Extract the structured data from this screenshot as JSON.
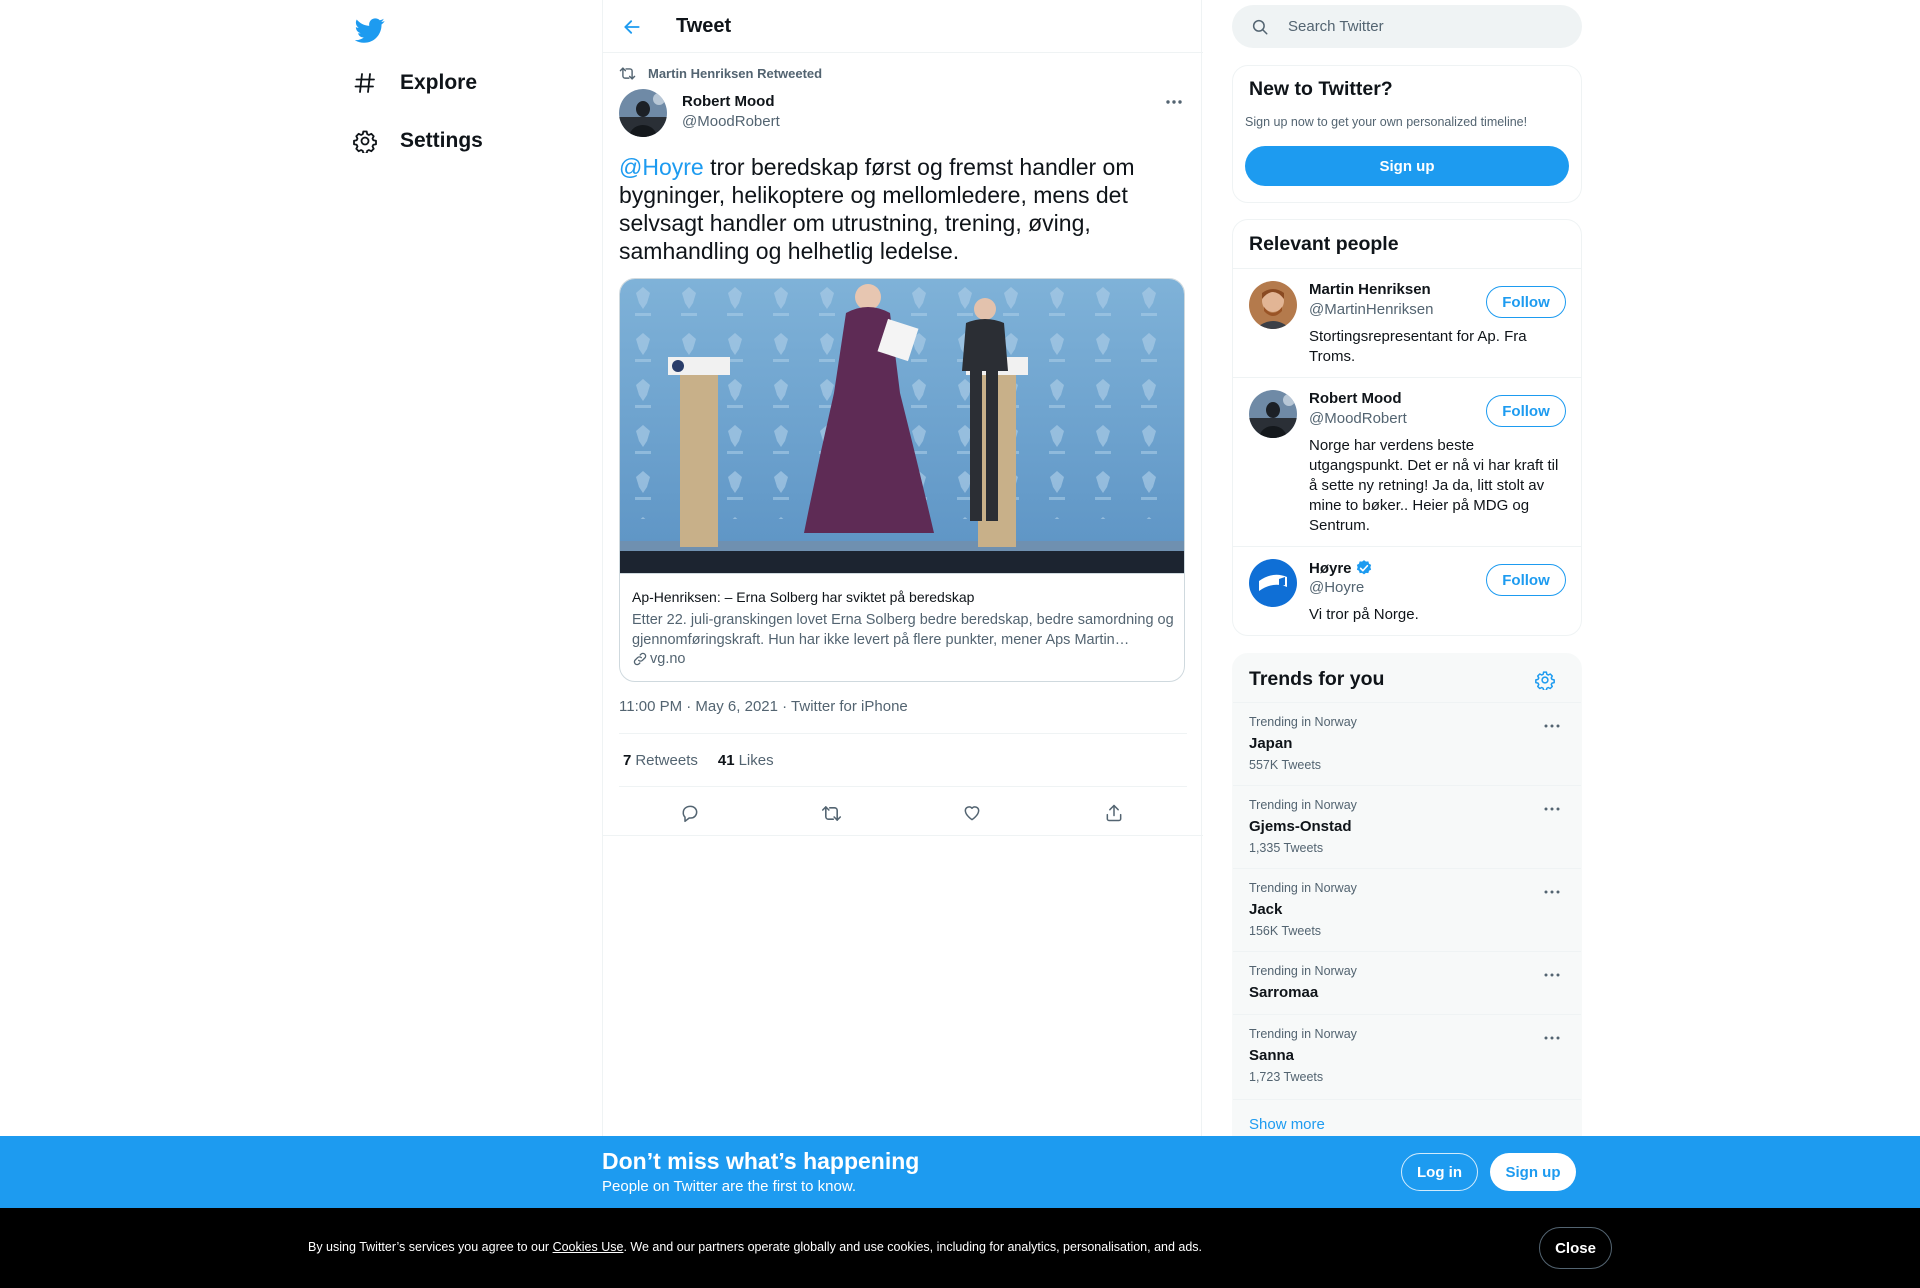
{
  "nav": {
    "logo_icon": "twitter-bird-icon",
    "items": [
      {
        "label": "Explore",
        "icon": "hashtag-icon"
      },
      {
        "label": "Settings",
        "icon": "gear-icon"
      }
    ]
  },
  "main": {
    "header_title": "Tweet",
    "back_icon": "arrow-left-icon",
    "retweet_context": "Martin Henriksen Retweeted",
    "author": {
      "name": "Robert Mood",
      "handle": "@MoodRobert"
    },
    "tweet": {
      "mention": "@Hoyre",
      "text": " tror beredskap først og fremst handler om bygninger, helikoptere og mellomledere, mens det selvsagt handler om utrustning, trening, øving, samhandling og helhetlig ledelse."
    },
    "card": {
      "title": "Ap-Henriksen: – Erna Solberg har sviktet på beredskap",
      "description": "Etter 22. juli-granskingen lovet Erna Solberg bedre beredskap, bedre samordning og gjennomføringskraft. Hun har ikke levert på flere punkter, mener Aps Martin…",
      "domain": "vg.no"
    },
    "meta": "11:00 PM · May 6, 2021 · Twitter for iPhone",
    "stats": {
      "retweets_count": "7",
      "retweets_label": "Retweets",
      "likes_count": "41",
      "likes_label": "Likes"
    }
  },
  "sidebar": {
    "search_placeholder": "Search Twitter",
    "new_to_twitter": {
      "title": "New to Twitter?",
      "subtitle": "Sign up now to get your own personalized timeline!",
      "button": "Sign up"
    },
    "relevant_people": {
      "title": "Relevant people",
      "follow_label": "Follow",
      "people": [
        {
          "name": "Martin Henriksen",
          "handle": "@MartinHenriksen",
          "bio": "Stortingsrepresentant for Ap. Fra Troms."
        },
        {
          "name": "Robert Mood",
          "handle": "@MoodRobert",
          "bio": "Norge har verdens beste utgangspunkt. Det er nå vi har kraft til å sette ny retning! Ja da, litt stolt av mine to bøker.. Heier på MDG og Sentrum."
        },
        {
          "name": "Høyre",
          "handle": "@Hoyre",
          "bio": "Vi tror på Norge.",
          "verified": true
        }
      ]
    },
    "trends": {
      "title": "Trends for you",
      "items": [
        {
          "context": "Trending in Norway",
          "name": "Japan",
          "count": "557K Tweets"
        },
        {
          "context": "Trending in Norway",
          "name": "Gjems-Onstad",
          "count": "1,335 Tweets"
        },
        {
          "context": "Trending in Norway",
          "name": "Jack",
          "count": "156K Tweets"
        },
        {
          "context": "Trending in Norway",
          "name": "Sarromaa",
          "count": ""
        },
        {
          "context": "Trending in Norway",
          "name": "Sanna",
          "count": "1,723 Tweets"
        }
      ],
      "show_more": "Show more"
    }
  },
  "banner": {
    "title": "Don’t miss what’s happening",
    "subtitle": "People on Twitter are the first to know.",
    "login": "Log in",
    "signup": "Sign up"
  },
  "cookie": {
    "text_before": "By using Twitter’s services you agree to our ",
    "link": "Cookies Use",
    "text_after": ". We and our partners operate globally and use cookies, including for analytics, personalisation, and ads.",
    "close": "Close"
  },
  "colors": {
    "accent": "#1d9bf0",
    "text": "#0f1419",
    "muted": "#536471",
    "cookie_bg": "#000000"
  }
}
